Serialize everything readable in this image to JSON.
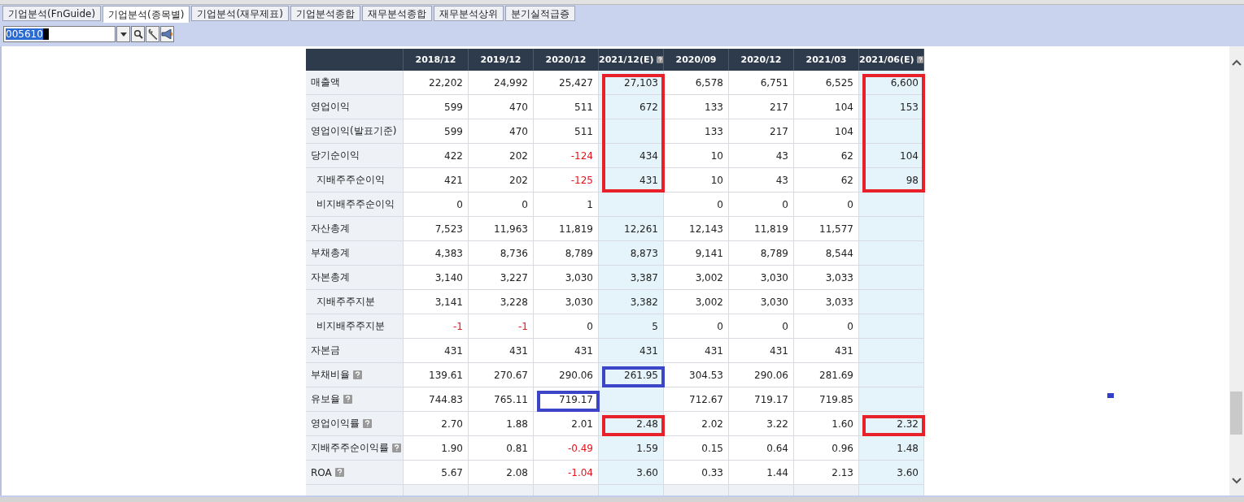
{
  "tabs": [
    {
      "label": "기업분석(FnGuide)",
      "selected": false
    },
    {
      "label": "기업분석(종목별)",
      "selected": true
    },
    {
      "label": "기업분석(재무제표)",
      "selected": false
    },
    {
      "label": "기업분석종합",
      "selected": false
    },
    {
      "label": "재무분석종합",
      "selected": false
    },
    {
      "label": "재무분석상위",
      "selected": false
    },
    {
      "label": "분기실적급증",
      "selected": false
    }
  ],
  "stock_code_field": {
    "value": "005610"
  },
  "table": {
    "columns": [
      {
        "label": "2018/12",
        "estimate": false
      },
      {
        "label": "2019/12",
        "estimate": false
      },
      {
        "label": "2020/12",
        "estimate": false
      },
      {
        "label": "2021/12(E)",
        "estimate": true
      },
      {
        "label": "2020/09",
        "estimate": false
      },
      {
        "label": "2020/12",
        "estimate": false
      },
      {
        "label": "2021/03",
        "estimate": false
      },
      {
        "label": "2021/06(E)",
        "estimate": true
      }
    ],
    "rows": [
      {
        "label": "매출액",
        "cells": [
          {
            "kind": "value",
            "text": "22,202",
            "negative": false
          },
          {
            "kind": "value",
            "text": "24,992",
            "negative": false
          },
          {
            "kind": "value",
            "text": "25,427",
            "negative": false
          },
          {
            "kind": "value",
            "text": "27,103",
            "negative": false,
            "color": "#e8202a"
          },
          {
            "kind": "value",
            "text": "6,578",
            "negative": false
          },
          {
            "kind": "value",
            "text": "6,751",
            "negative": false
          },
          {
            "kind": "value",
            "text": "6,525",
            "negative": false
          },
          {
            "kind": "value",
            "text": "6,600",
            "negative": false,
            "color": "#e8202a"
          }
        ]
      },
      {
        "label": "영업이익",
        "cells": [
          {
            "kind": "value",
            "text": "599",
            "negative": false
          },
          {
            "kind": "value",
            "text": "470",
            "negative": false
          },
          {
            "kind": "value",
            "text": "511",
            "negative": false
          },
          {
            "kind": "value",
            "text": "672",
            "negative": false,
            "color": "#e8202a"
          },
          {
            "kind": "value",
            "text": "133",
            "negative": false
          },
          {
            "kind": "value",
            "text": "217",
            "negative": false
          },
          {
            "kind": "value",
            "text": "104",
            "negative": false
          },
          {
            "kind": "value",
            "text": "153",
            "negative": false,
            "color": "#e8202a"
          }
        ]
      },
      {
        "label": "영업이익(발표기준)",
        "cells": [
          {
            "kind": "value",
            "text": "599",
            "negative": false
          },
          {
            "kind": "value",
            "text": "470",
            "negative": false
          },
          {
            "kind": "value",
            "text": "511",
            "negative": false
          },
          {
            "kind": "empty",
            "color": "#e8202a"
          },
          {
            "kind": "value",
            "text": "133",
            "negative": false
          },
          {
            "kind": "value",
            "text": "217",
            "negative": false
          },
          {
            "kind": "value",
            "text": "104",
            "negative": false
          },
          {
            "kind": "empty",
            "color": "#e8202a"
          }
        ]
      },
      {
        "label": "당기순이익",
        "cells": [
          {
            "kind": "value",
            "text": "422",
            "negative": false
          },
          {
            "kind": "value",
            "text": "202",
            "negative": false
          },
          {
            "kind": "value",
            "text": "-124",
            "negative": true
          },
          {
            "kind": "value",
            "text": "434",
            "negative": false,
            "color": "#e8202a"
          },
          {
            "kind": "value",
            "text": "10",
            "negative": false
          },
          {
            "kind": "value",
            "text": "43",
            "negative": false
          },
          {
            "kind": "value",
            "text": "62",
            "negative": false
          },
          {
            "kind": "value",
            "text": "104",
            "negative": false,
            "color": "#e8202a"
          }
        ],
        "children": [
          {
            "label": "지배주주순이익",
            "cells": [
              {
                "kind": "value",
                "text": "421",
                "negative": false
              },
              {
                "kind": "value",
                "text": "202",
                "negative": false
              },
              {
                "kind": "value",
                "text": "-125",
                "negative": true
              },
              {
                "kind": "value",
                "text": "431",
                "negative": false,
                "color": "#e8202a"
              },
              {
                "kind": "value",
                "text": "10",
                "negative": false
              },
              {
                "kind": "value",
                "text": "43",
                "negative": false
              },
              {
                "kind": "value",
                "text": "62",
                "negative": false
              },
              {
                "kind": "value",
                "text": "98",
                "negative": false,
                "color": "#e8202a"
              }
            ]
          },
          {
            "label": "비지배주주순이익",
            "cells": [
              {
                "kind": "value",
                "text": "0",
                "negative": false
              },
              {
                "kind": "value",
                "text": "0",
                "negative": false
              },
              {
                "kind": "value",
                "text": "1",
                "negative": false
              },
              {
                "kind": "empty"
              },
              {
                "kind": "value",
                "text": "0",
                "negative": false
              },
              {
                "kind": "value",
                "text": "0",
                "negative": false
              },
              {
                "kind": "value",
                "text": "0",
                "negative": false
              },
              {
                "kind": "empty"
              }
            ]
          }
        ]
      },
      {
        "label": "자산총계",
        "cells": [
          {
            "kind": "value",
            "text": "7,523",
            "negative": false
          },
          {
            "kind": "value",
            "text": "11,963",
            "negative": false
          },
          {
            "kind": "value",
            "text": "11,819",
            "negative": false
          },
          {
            "kind": "value",
            "text": "12,261",
            "negative": false
          },
          {
            "kind": "value",
            "text": "12,143",
            "negative": false
          },
          {
            "kind": "value",
            "text": "11,819",
            "negative": false
          },
          {
            "kind": "value",
            "text": "11,577",
            "negative": false
          },
          {
            "kind": "empty"
          }
        ]
      },
      {
        "label": "부채총계",
        "cells": [
          {
            "kind": "value",
            "text": "4,383",
            "negative": false
          },
          {
            "kind": "value",
            "text": "8,736",
            "negative": false
          },
          {
            "kind": "value",
            "text": "8,789",
            "negative": false
          },
          {
            "kind": "value",
            "text": "8,873",
            "negative": false
          },
          {
            "kind": "value",
            "text": "9,141",
            "negative": false
          },
          {
            "kind": "value",
            "text": "8,789",
            "negative": false
          },
          {
            "kind": "value",
            "text": "8,544",
            "negative": false
          },
          {
            "kind": "empty"
          }
        ]
      },
      {
        "label": "자본총계",
        "cells": [
          {
            "kind": "value",
            "text": "3,140",
            "negative": false
          },
          {
            "kind": "value",
            "text": "3,227",
            "negative": false
          },
          {
            "kind": "value",
            "text": "3,030",
            "negative": false
          },
          {
            "kind": "value",
            "text": "3,387",
            "negative": false
          },
          {
            "kind": "value",
            "text": "3,002",
            "negative": false
          },
          {
            "kind": "value",
            "text": "3,030",
            "negative": false
          },
          {
            "kind": "value",
            "text": "3,033",
            "negative": false
          },
          {
            "kind": "empty"
          }
        ],
        "children": [
          {
            "label": "지배주주지분",
            "cells": [
              {
                "kind": "value",
                "text": "3,141",
                "negative": false
              },
              {
                "kind": "value",
                "text": "3,228",
                "negative": false
              },
              {
                "kind": "value",
                "text": "3,030",
                "negative": false
              },
              {
                "kind": "value",
                "text": "3,382",
                "negative": false
              },
              {
                "kind": "value",
                "text": "3,002",
                "negative": false
              },
              {
                "kind": "value",
                "text": "3,030",
                "negative": false
              },
              {
                "kind": "value",
                "text": "3,033",
                "negative": false
              },
              {
                "kind": "empty"
              }
            ]
          },
          {
            "label": "비지배주주지분",
            "cells": [
              {
                "kind": "value",
                "text": "-1",
                "negative": true
              },
              {
                "kind": "value",
                "text": "-1",
                "negative": true
              },
              {
                "kind": "value",
                "text": "0",
                "negative": false
              },
              {
                "kind": "value",
                "text": "5",
                "negative": false
              },
              {
                "kind": "value",
                "text": "0",
                "negative": false
              },
              {
                "kind": "value",
                "text": "0",
                "negative": false
              },
              {
                "kind": "value",
                "text": "0",
                "negative": false
              },
              {
                "kind": "empty"
              }
            ]
          }
        ]
      },
      {
        "label": "자본금",
        "cells": [
          {
            "kind": "value",
            "text": "431",
            "negative": false
          },
          {
            "kind": "value",
            "text": "431",
            "negative": false
          },
          {
            "kind": "value",
            "text": "431",
            "negative": false
          },
          {
            "kind": "value",
            "text": "431",
            "negative": false
          },
          {
            "kind": "value",
            "text": "431",
            "negative": false
          },
          {
            "kind": "value",
            "text": "431",
            "negative": false
          },
          {
            "kind": "value",
            "text": "431",
            "negative": false
          },
          {
            "kind": "empty"
          }
        ]
      },
      {
        "label": "부채비율",
        "help": true,
        "cells": [
          {
            "kind": "value",
            "text": "139.61",
            "negative": false
          },
          {
            "kind": "value",
            "text": "270.67",
            "negative": false
          },
          {
            "kind": "value",
            "text": "290.06",
            "negative": false
          },
          {
            "kind": "value",
            "text": "261.95",
            "negative": false,
            "color": "#3c44c8"
          },
          {
            "kind": "value",
            "text": "304.53",
            "negative": false
          },
          {
            "kind": "value",
            "text": "290.06",
            "negative": false
          },
          {
            "kind": "value",
            "text": "281.69",
            "negative": false
          },
          {
            "kind": "empty"
          }
        ]
      },
      {
        "label": "유보율",
        "help": true,
        "cells": [
          {
            "kind": "value",
            "text": "744.83",
            "negative": false
          },
          {
            "kind": "value",
            "text": "765.11",
            "negative": false
          },
          {
            "kind": "value",
            "text": "719.17",
            "negative": false,
            "color": "#3c44c8"
          },
          {
            "kind": "empty"
          },
          {
            "kind": "value",
            "text": "712.67",
            "negative": false
          },
          {
            "kind": "value",
            "text": "719.17",
            "negative": false
          },
          {
            "kind": "value",
            "text": "719.85",
            "negative": false
          },
          {
            "kind": "empty"
          }
        ]
      },
      {
        "label": "영업이익률",
        "help": true,
        "cells": [
          {
            "kind": "value",
            "text": "2.70",
            "negative": false
          },
          {
            "kind": "value",
            "text": "1.88",
            "negative": false
          },
          {
            "kind": "value",
            "text": "2.01",
            "negative": false
          },
          {
            "kind": "value",
            "text": "2.48",
            "negative": false,
            "color": "#e8202a"
          },
          {
            "kind": "value",
            "text": "2.02",
            "negative": false
          },
          {
            "kind": "value",
            "text": "3.22",
            "negative": false
          },
          {
            "kind": "value",
            "text": "1.60",
            "negative": false
          },
          {
            "kind": "value",
            "text": "2.32",
            "negative": false,
            "color": "#e8202a"
          }
        ]
      },
      {
        "label": "지배주주순이익률",
        "help": true,
        "cells": [
          {
            "kind": "value",
            "text": "1.90",
            "negative": false
          },
          {
            "kind": "value",
            "text": "0.81",
            "negative": false
          },
          {
            "kind": "value",
            "text": "-0.49",
            "negative": true
          },
          {
            "kind": "value",
            "text": "1.59",
            "negative": false
          },
          {
            "kind": "value",
            "text": "0.15",
            "negative": false
          },
          {
            "kind": "value",
            "text": "0.64",
            "negative": false
          },
          {
            "kind": "value",
            "text": "0.96",
            "negative": false
          },
          {
            "kind": "value",
            "text": "1.48",
            "negative": false
          }
        ]
      },
      {
        "label": "ROA",
        "help": true,
        "cells": [
          {
            "kind": "value",
            "text": "5.67",
            "negative": false
          },
          {
            "kind": "value",
            "text": "2.08",
            "negative": false
          },
          {
            "kind": "value",
            "text": "-1.04",
            "negative": true
          },
          {
            "kind": "value",
            "text": "3.60",
            "negative": false
          },
          {
            "kind": "value",
            "text": "0.33",
            "negative": false
          },
          {
            "kind": "value",
            "text": "1.44",
            "negative": false
          },
          {
            "kind": "value",
            "text": "2.13",
            "negative": false
          },
          {
            "kind": "value",
            "text": "3.60",
            "negative": false
          }
        ]
      }
    ]
  }
}
